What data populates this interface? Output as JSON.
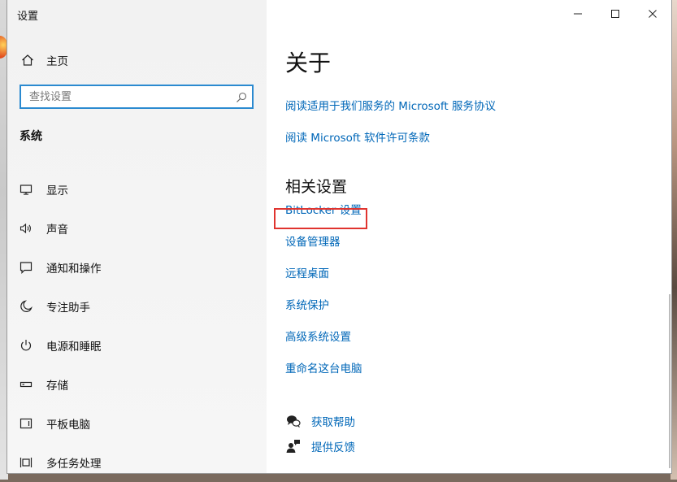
{
  "window": {
    "title": "设置",
    "controls": {
      "minimize": "minimize",
      "maximize": "maximize",
      "close": "close"
    }
  },
  "sidebar": {
    "home_label": "主页",
    "search_placeholder": "查找设置",
    "section_title": "系统",
    "items": [
      {
        "label": "显示",
        "icon": "monitor-icon"
      },
      {
        "label": "声音",
        "icon": "speaker-icon"
      },
      {
        "label": "通知和操作",
        "icon": "notification-icon"
      },
      {
        "label": "专注助手",
        "icon": "moon-icon"
      },
      {
        "label": "电源和睡眠",
        "icon": "power-icon"
      },
      {
        "label": "存储",
        "icon": "storage-icon"
      },
      {
        "label": "平板电脑",
        "icon": "tablet-icon"
      },
      {
        "label": "多任务处理",
        "icon": "multitask-icon"
      }
    ]
  },
  "main": {
    "title": "关于",
    "links": [
      "阅读适用于我们服务的 Microsoft 服务协议",
      "阅读 Microsoft 软件许可条款"
    ],
    "related_title": "相关设置",
    "related_links": [
      "BitLocker 设置",
      "设备管理器",
      "远程桌面",
      "系统保护",
      "高级系统设置",
      "重命名这台电脑"
    ],
    "highlighted_link": "设备管理器",
    "help": {
      "get_help": "获取帮助",
      "feedback": "提供反馈"
    }
  },
  "colors": {
    "link": "#0067b8",
    "accent_border": "#2b8ad0",
    "highlight_box": "#e0342f"
  }
}
